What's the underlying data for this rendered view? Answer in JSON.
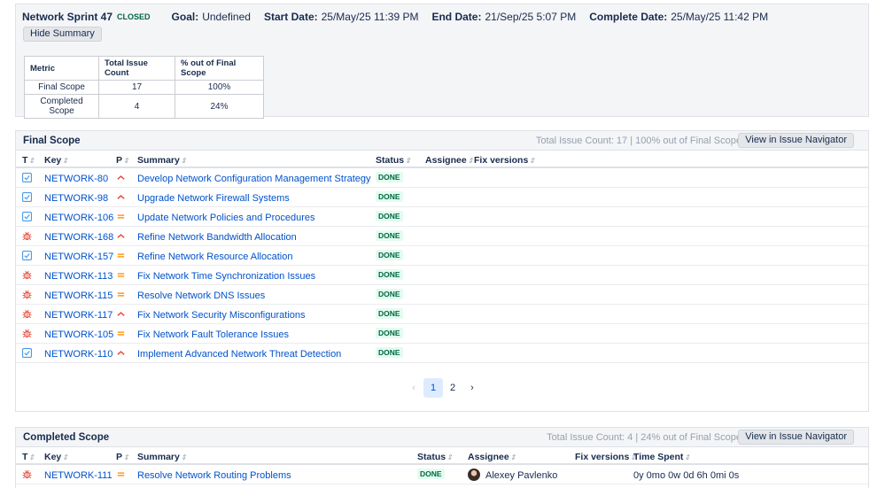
{
  "sprint": {
    "name": "Network Sprint 47",
    "state": "CLOSED",
    "goal_label": "Goal:",
    "goal": "Undefined",
    "start_label": "Start Date:",
    "start": "25/May/25 11:39 PM",
    "end_label": "End Date:",
    "end": "21/Sep/25 5:07 PM",
    "complete_label": "Complete Date:",
    "complete": "25/May/25 11:42 PM",
    "hide_summary_label": "Hide Summary"
  },
  "metrics": {
    "headers": [
      "Metric",
      "Total Issue Count",
      "% out of Final Scope"
    ],
    "rows": [
      [
        "Final Scope",
        "17",
        "100%"
      ],
      [
        "Completed Scope",
        "4",
        "24%"
      ]
    ]
  },
  "final_scope": {
    "title": "Final Scope",
    "stats": "Total Issue Count: 17 | 100% out of Final Scope",
    "navigator_label": "View in Issue Navigator",
    "columns": {
      "type": "T",
      "key": "Key",
      "priority": "P",
      "summary": "Summary",
      "status": "Status",
      "assignee": "Assignee",
      "fix": "Fix versions"
    },
    "issues": [
      {
        "type": "task",
        "key": "NETWORK-80",
        "priority": "high",
        "summary": "Develop Network Configuration Management Strategy",
        "status": "DONE"
      },
      {
        "type": "task",
        "key": "NETWORK-98",
        "priority": "high",
        "summary": "Upgrade Network Firewall Systems",
        "status": "DONE"
      },
      {
        "type": "task",
        "key": "NETWORK-106",
        "priority": "medium",
        "summary": "Update Network Policies and Procedures",
        "status": "DONE"
      },
      {
        "type": "bug",
        "key": "NETWORK-168",
        "priority": "high",
        "summary": "Refine Network Bandwidth Allocation",
        "status": "DONE"
      },
      {
        "type": "task",
        "key": "NETWORK-157",
        "priority": "medium",
        "summary": "Refine Network Resource Allocation",
        "status": "DONE"
      },
      {
        "type": "bug",
        "key": "NETWORK-113",
        "priority": "medium",
        "summary": "Fix Network Time Synchronization Issues",
        "status": "DONE"
      },
      {
        "type": "bug",
        "key": "NETWORK-115",
        "priority": "medium",
        "summary": "Resolve Network DNS Issues",
        "status": "DONE"
      },
      {
        "type": "bug",
        "key": "NETWORK-117",
        "priority": "high",
        "summary": "Fix Network Security Misconfigurations",
        "status": "DONE"
      },
      {
        "type": "bug",
        "key": "NETWORK-105",
        "priority": "medium",
        "summary": "Fix Network Fault Tolerance Issues",
        "status": "DONE"
      },
      {
        "type": "task",
        "key": "NETWORK-110",
        "priority": "high",
        "summary": "Implement Advanced Network Threat Detection",
        "status": "DONE"
      }
    ],
    "pagination": {
      "prev": "‹",
      "pages": [
        "1",
        "2"
      ],
      "current": "1",
      "next": "›"
    }
  },
  "completed_scope": {
    "title": "Completed Scope",
    "stats": "Total Issue Count: 4 | 24% out of Final Scope",
    "navigator_label": "View in Issue Navigator",
    "columns": {
      "type": "T",
      "key": "Key",
      "priority": "P",
      "summary": "Summary",
      "status": "Status",
      "assignee": "Assignee",
      "fix": "Fix versions",
      "time": "Time Spent"
    },
    "issues": [
      {
        "type": "bug",
        "key": "NETWORK-111",
        "priority": "medium",
        "summary": "Resolve Network Routing Problems",
        "status": "DONE",
        "assignee": "Alexey Pavlenko",
        "time_spent": "0y 0mo 0w 0d 6h 0mi 0s"
      }
    ]
  },
  "colors": {
    "link": "#0052cc",
    "done_bg": "#e3fcef",
    "done_text": "#006644",
    "high_priority": "#e5493a",
    "medium_priority": "#ff991f",
    "task_icon": "#4a9ae8",
    "bug_icon": "#e5493a"
  }
}
